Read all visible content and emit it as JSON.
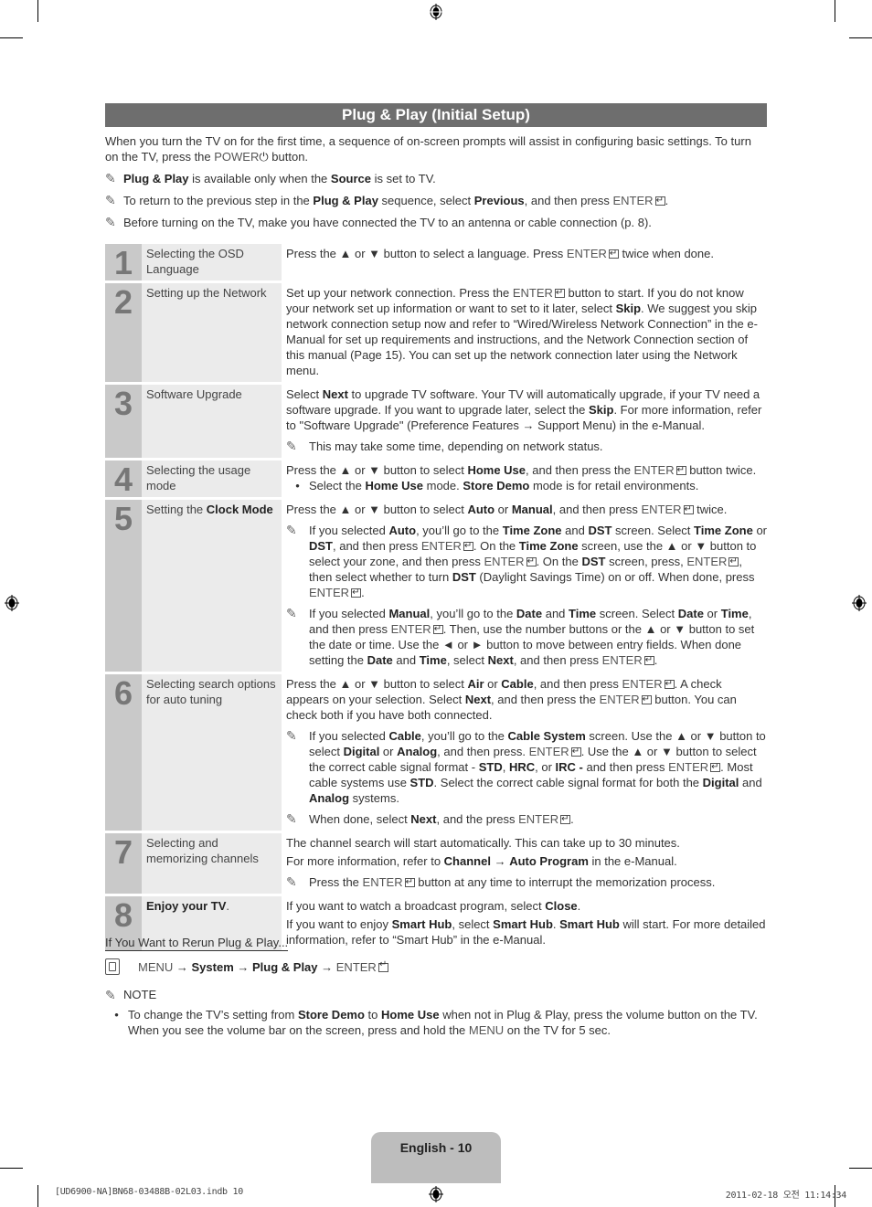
{
  "section_title": "Plug & Play (Initial Setup)",
  "intro": {
    "text_a": "When you turn the TV on for the first time, a sequence of on-screen prompts will assist in configuring basic settings. To turn on the TV, press the ",
    "power": "POWER",
    "power_icon": "⏻",
    "text_b": " button."
  },
  "notes": [
    {
      "icon": "✎",
      "parts": [
        [
          "b",
          "Plug & Play"
        ],
        [
          "t",
          " is available only when the "
        ],
        [
          "b",
          "Source"
        ],
        [
          "t",
          " is set to TV."
        ]
      ]
    },
    {
      "icon": "✎",
      "parts": [
        [
          "t",
          "To return to the previous step in the "
        ],
        [
          "b",
          "Plug & Play"
        ],
        [
          "t",
          " sequence, select "
        ],
        [
          "b",
          "Previous"
        ],
        [
          "t",
          ", and then press "
        ],
        [
          "e",
          "ENTER"
        ],
        [
          "t",
          "."
        ]
      ]
    },
    {
      "icon": "✎",
      "parts": [
        [
          "t",
          "Before turning on the TV, make you have connected the TV to an antenna or cable connection (p. 8)."
        ]
      ]
    }
  ],
  "steps": [
    {
      "num": "1",
      "label": [
        [
          "t",
          "Selecting the OSD Language"
        ]
      ],
      "blocks": [
        {
          "type": "p",
          "parts": [
            [
              "t",
              "Press the ▲ or ▼ button to select a language. Press "
            ],
            [
              "e",
              "ENTER"
            ],
            [
              "t",
              " twice when done."
            ]
          ]
        }
      ]
    },
    {
      "num": "2",
      "label": [
        [
          "t",
          "Setting up the Network"
        ]
      ],
      "blocks": [
        {
          "type": "p",
          "parts": [
            [
              "t",
              "Set up your network connection. Press the "
            ],
            [
              "e",
              "ENTER"
            ],
            [
              "t",
              " button to start. If you do not know your network set up information or want to set to it later, select "
            ],
            [
              "b",
              "Skip"
            ],
            [
              "t",
              ". We suggest you skip network connection setup now and refer to “Wired/Wireless Network Connection” in the e-Manual for set up requirements and instructions, and the Network Connection section of this manual (Page 15). You can set up the network connection later using the Network menu."
            ]
          ]
        }
      ]
    },
    {
      "num": "3",
      "label": [
        [
          "t",
          "Software Upgrade"
        ]
      ],
      "blocks": [
        {
          "type": "p",
          "parts": [
            [
              "t",
              "Select "
            ],
            [
              "b",
              "Next"
            ],
            [
              "t",
              " to upgrade TV software. Your TV will automatically upgrade, if your TV need a software upgrade. If you want to upgrade later, select the "
            ],
            [
              "b",
              "Skip"
            ],
            [
              "t",
              ". For more information, refer to \"Software Upgrade\" (Preference Features → Support Menu) in the e-Manual."
            ]
          ]
        },
        {
          "type": "note",
          "parts": [
            [
              "t",
              "This may take some time, depending on network status."
            ]
          ]
        }
      ]
    },
    {
      "num": "4",
      "label": [
        [
          "t",
          "Selecting the usage mode"
        ]
      ],
      "blocks": [
        {
          "type": "p",
          "parts": [
            [
              "t",
              "Press the ▲ or ▼ button to select "
            ],
            [
              "b",
              "Home Use"
            ],
            [
              "t",
              ", and then press the "
            ],
            [
              "e",
              "ENTER"
            ],
            [
              "t",
              " button twice."
            ]
          ]
        },
        {
          "type": "bullet",
          "parts": [
            [
              "t",
              "Select the "
            ],
            [
              "b",
              "Home Use"
            ],
            [
              "t",
              " mode. "
            ],
            [
              "b",
              "Store Demo"
            ],
            [
              "t",
              " mode is for retail environments."
            ]
          ]
        }
      ]
    },
    {
      "num": "5",
      "label": [
        [
          "t",
          "Setting the "
        ],
        [
          "b",
          "Clock Mode"
        ]
      ],
      "blocks": [
        {
          "type": "p",
          "parts": [
            [
              "t",
              "Press the ▲ or ▼ button to select "
            ],
            [
              "b",
              "Auto"
            ],
            [
              "t",
              " or "
            ],
            [
              "b",
              "Manual"
            ],
            [
              "t",
              ", and then press "
            ],
            [
              "e",
              "ENTER"
            ],
            [
              "t",
              " twice."
            ]
          ]
        },
        {
          "type": "note",
          "parts": [
            [
              "t",
              "If you selected "
            ],
            [
              "b",
              "Auto"
            ],
            [
              "t",
              ", you’ll go to the "
            ],
            [
              "b",
              "Time Zone"
            ],
            [
              "t",
              " and "
            ],
            [
              "b",
              "DST"
            ],
            [
              "t",
              " screen. Select "
            ],
            [
              "b",
              "Time Zone"
            ],
            [
              "t",
              " or "
            ],
            [
              "b",
              "DST"
            ],
            [
              "t",
              ", and then press "
            ],
            [
              "e",
              "ENTER"
            ],
            [
              "t",
              ". On the "
            ],
            [
              "b",
              "Time Zone"
            ],
            [
              "t",
              " screen, use the ▲ or ▼ button to select your zone, and then press "
            ],
            [
              "e",
              "ENTER"
            ],
            [
              "t",
              ". On the "
            ],
            [
              "b",
              "DST"
            ],
            [
              "t",
              " screen, press, "
            ],
            [
              "e",
              "ENTER"
            ],
            [
              "t",
              ", then select whether to turn "
            ],
            [
              "b",
              "DST"
            ],
            [
              "t",
              " (Daylight Savings Time) on or off. When done, press "
            ],
            [
              "e",
              "ENTER"
            ],
            [
              "t",
              "."
            ]
          ]
        },
        {
          "type": "note",
          "parts": [
            [
              "t",
              "If you selected "
            ],
            [
              "b",
              "Manual"
            ],
            [
              "t",
              ", you’ll go to the "
            ],
            [
              "b",
              "Date"
            ],
            [
              "t",
              " and "
            ],
            [
              "b",
              "Time"
            ],
            [
              "t",
              " screen. Select "
            ],
            [
              "b",
              "Date"
            ],
            [
              "t",
              " or "
            ],
            [
              "b",
              "Time"
            ],
            [
              "t",
              ", and then press "
            ],
            [
              "e",
              "ENTER"
            ],
            [
              "t",
              ". Then, use the number buttons or the ▲ or ▼ button to set the date or time. Use the ◄ or ► button to move between entry fields. When done setting the "
            ],
            [
              "b",
              "Date"
            ],
            [
              "t",
              " and "
            ],
            [
              "b",
              "Time"
            ],
            [
              "t",
              ", select "
            ],
            [
              "b",
              "Next"
            ],
            [
              "t",
              ", and then press "
            ],
            [
              "e",
              "ENTER"
            ],
            [
              "t",
              "."
            ]
          ]
        }
      ]
    },
    {
      "num": "6",
      "label": [
        [
          "t",
          "Selecting search options for auto tuning"
        ]
      ],
      "blocks": [
        {
          "type": "p",
          "parts": [
            [
              "t",
              "Press the ▲ or ▼ button to select "
            ],
            [
              "b",
              "Air"
            ],
            [
              "t",
              " or "
            ],
            [
              "b",
              "Cable"
            ],
            [
              "t",
              ", and then press "
            ],
            [
              "e",
              "ENTER"
            ],
            [
              "t",
              ". A check appears on your selection. Select "
            ],
            [
              "b",
              "Next"
            ],
            [
              "t",
              ", and then press the "
            ],
            [
              "e",
              "ENTER"
            ],
            [
              "t",
              " button. You can check both if you have both connected."
            ]
          ]
        },
        {
          "type": "note",
          "parts": [
            [
              "t",
              "If you selected "
            ],
            [
              "b",
              "Cable"
            ],
            [
              "t",
              ", you’ll go to the "
            ],
            [
              "b",
              "Cable System"
            ],
            [
              "t",
              " screen. Use the ▲ or ▼ button to select "
            ],
            [
              "b",
              "Digital"
            ],
            [
              "t",
              " or "
            ],
            [
              "b",
              "Analog"
            ],
            [
              "t",
              ", and then press. "
            ],
            [
              "e",
              "ENTER"
            ],
            [
              "t",
              ". Use the ▲ or ▼ button to select the correct cable signal format - "
            ],
            [
              "b",
              "STD"
            ],
            [
              "t",
              ", "
            ],
            [
              "b",
              "HRC"
            ],
            [
              "t",
              ", or "
            ],
            [
              "b",
              "IRC -"
            ],
            [
              "t",
              " and then press "
            ],
            [
              "e",
              "ENTER"
            ],
            [
              "t",
              ". Most cable systems use "
            ],
            [
              "b",
              "STD"
            ],
            [
              "t",
              ". Select the correct cable signal format for both the "
            ],
            [
              "b",
              "Digital"
            ],
            [
              "t",
              " and "
            ],
            [
              "b",
              "Analog"
            ],
            [
              "t",
              " systems."
            ]
          ]
        },
        {
          "type": "note",
          "parts": [
            [
              "t",
              "When done, select "
            ],
            [
              "b",
              "Next"
            ],
            [
              "t",
              ", and the press "
            ],
            [
              "e",
              "ENTER"
            ],
            [
              "t",
              "."
            ]
          ]
        }
      ]
    },
    {
      "num": "7",
      "label": [
        [
          "t",
          "Selecting and memorizing channels"
        ]
      ],
      "blocks": [
        {
          "type": "p",
          "parts": [
            [
              "t",
              "The channel search will start automatically. This can take up to 30 minutes."
            ]
          ]
        },
        {
          "type": "p2",
          "parts": [
            [
              "t",
              "For more information, refer to "
            ],
            [
              "b",
              "Channel"
            ],
            [
              "t",
              " → "
            ],
            [
              "b",
              "Auto Program"
            ],
            [
              "t",
              " in the e-Manual."
            ]
          ]
        },
        {
          "type": "note",
          "parts": [
            [
              "t",
              "Press the "
            ],
            [
              "e",
              "ENTER"
            ],
            [
              "t",
              " button at any time to interrupt the memorization process."
            ]
          ]
        }
      ]
    },
    {
      "num": "8",
      "label": [
        [
          "b",
          "Enjoy your TV"
        ],
        [
          "t",
          "."
        ]
      ],
      "blocks": [
        {
          "type": "p",
          "parts": [
            [
              "t",
              "If you want to watch a broadcast program, select "
            ],
            [
              "b",
              "Close"
            ],
            [
              "t",
              "."
            ]
          ]
        },
        {
          "type": "p2",
          "parts": [
            [
              "t",
              "If you want to enjoy "
            ],
            [
              "b",
              "Smart Hub"
            ],
            [
              "t",
              ", select "
            ],
            [
              "b",
              "Smart Hub"
            ],
            [
              "t",
              ". "
            ],
            [
              "b",
              "Smart Hub"
            ],
            [
              "t",
              " will start. For more detailed information, refer to “Smart Hub” in the e-Manual."
            ]
          ]
        }
      ]
    }
  ],
  "rerun": {
    "title": "If You Want to Rerun Plug & Play...",
    "menu_icon": "menu-icon",
    "path": [
      [
        "g",
        "MENU"
      ],
      [
        "t",
        " → "
      ],
      [
        "b",
        "System"
      ],
      [
        "t",
        " → "
      ],
      [
        "b",
        "Plug & Play"
      ],
      [
        "t",
        " → "
      ],
      [
        "e",
        "ENTER"
      ]
    ]
  },
  "note_section": {
    "icon": "✎",
    "heading": "NOTE",
    "bullets": [
      [
        [
          "t",
          "To change the TV’s setting from "
        ],
        [
          "b",
          "Store Demo"
        ],
        [
          "t",
          " to "
        ],
        [
          "b",
          "Home Use"
        ],
        [
          "t",
          " when not in Plug & Play, press the volume button on the TV. When you see the volume bar on the screen, press and hold the "
        ],
        [
          "g",
          "MENU"
        ],
        [
          "t",
          " on the TV for 5 sec."
        ]
      ]
    ]
  },
  "footer": {
    "page_label": "English - 10",
    "file_info": "[UD6900-NA]BN68-03488B-02L03.indb   10",
    "timestamp": "2011-02-18   오전 11:14:34"
  }
}
